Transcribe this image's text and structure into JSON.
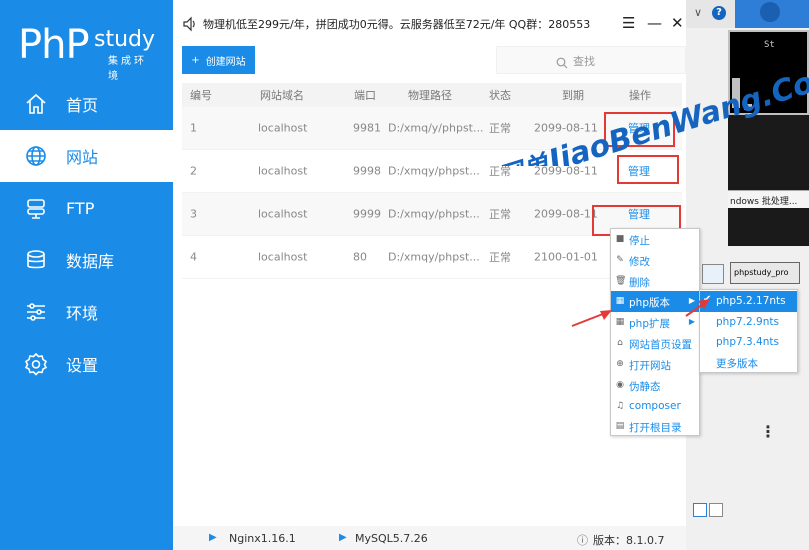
{
  "sidebar": {
    "logo": {
      "main": "PhP",
      "study": "study",
      "sub": "集成环境"
    },
    "items": [
      {
        "label": "首页",
        "icon": "home-icon"
      },
      {
        "label": "网站",
        "icon": "globe-icon"
      },
      {
        "label": "FTP",
        "icon": "ftp-icon"
      },
      {
        "label": "数据库",
        "icon": "database-icon"
      },
      {
        "label": "环境",
        "icon": "sliders-icon"
      },
      {
        "label": "设置",
        "icon": "gear-icon"
      }
    ],
    "active_index": 1
  },
  "topbar": {
    "notice": "物理机低至299元/年，拼团成功0元得。云服务器低至72元/年   QQ群：280553",
    "buttons": {
      "menu": "☰",
      "minimize": "—",
      "close": "✕"
    }
  },
  "toolbar": {
    "create_label": "创建网站",
    "create_icon": "+",
    "search_placeholder": "查找"
  },
  "table": {
    "headers": [
      "编号",
      "网站域名",
      "端口",
      "物理路径",
      "状态",
      "到期",
      "操作"
    ],
    "rows": [
      {
        "num": "1",
        "domain": "localhost",
        "port": "9981",
        "path": "D:/xmq/y/phpst...",
        "status": "正常",
        "date": "2099-08-11",
        "op": "管理"
      },
      {
        "num": "2",
        "domain": "localhost",
        "port": "9998",
        "path": "D:/xmqy/phpst...",
        "status": "正常",
        "date": "2099-08-11",
        "op": "管理"
      },
      {
        "num": "3",
        "domain": "localhost",
        "port": "9999",
        "path": "D:/xmqy/phpst...",
        "status": "正常",
        "date": "2099-08-11",
        "op": "管理"
      },
      {
        "num": "4",
        "domain": "localhost",
        "port": "80",
        "path": "D:/xmqy/phpst...",
        "status": "正常",
        "date": "2100-01-01",
        "op": ""
      }
    ]
  },
  "context_menu": {
    "items": [
      {
        "label": "停止",
        "icon": "stop-icon",
        "glyph": "■"
      },
      {
        "label": "修改",
        "icon": "pencil-icon",
        "glyph": "✎"
      },
      {
        "label": "删除",
        "icon": "trash-icon",
        "glyph": "🗑"
      },
      {
        "label": "php版本",
        "icon": "php-icon",
        "glyph": "▦",
        "has_sub": true
      },
      {
        "label": "php扩展",
        "icon": "extension-icon",
        "glyph": "▦",
        "has_sub": true
      },
      {
        "label": "网站首页设置",
        "icon": "homepage-icon",
        "glyph": "⌂"
      },
      {
        "label": "打开网站",
        "icon": "open-site-icon",
        "glyph": "⊕"
      },
      {
        "label": "伪静态",
        "icon": "rewrite-icon",
        "glyph": "◉"
      },
      {
        "label": "composer",
        "icon": "composer-icon",
        "glyph": "♫"
      },
      {
        "label": "打开根目录",
        "icon": "folder-icon",
        "glyph": "▤"
      }
    ],
    "highlighted_index": 3
  },
  "submenu": {
    "items": [
      {
        "label": "php5.2.17nts",
        "checked": true
      },
      {
        "label": "php7.2.9nts",
        "checked": false
      },
      {
        "label": "php7.3.4nts",
        "checked": false
      },
      {
        "label": "更多版本",
        "checked": false
      }
    ],
    "highlighted_index": 0
  },
  "statusbar": {
    "nginx": "Nginx1.16.1",
    "mysql": "MySQL5.7.26",
    "version": "版本：8.1.0.7",
    "play": "▶",
    "version_icon": "ⓘ"
  },
  "watermark": {
    "cn": "脚本王网单",
    "en": "JiaoBenWang.Com"
  },
  "background": {
    "help": "?",
    "console_text": "St",
    "winbar_text": "ndows 批处理...",
    "task_text": "phpstudy_pro",
    "dots": "⋮",
    "chevron": "∨"
  },
  "colors": {
    "brand": "#1a8ce8",
    "highlight_box": "#e53935",
    "watermark": "#1565c0"
  }
}
